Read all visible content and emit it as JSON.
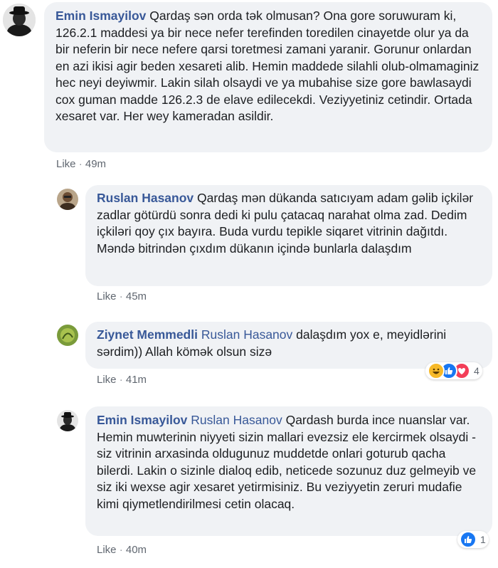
{
  "comments": [
    {
      "name": "Emin Ismayilov",
      "text": "Qardaş sən orda tək olmusan? Ona gore soruwuram ki, 126.2.1 maddesi ya bir nece nefer terefinden toredilen cinayetde olur ya da bir neferin bir nece nefere qarsi toretmesi zamani yaranir. Gorunur onlardan en azi ikisi agir beden xesareti alib. Hemin maddede silahli olub-olmamaginiz hec neyi deyiwmir. Lakin silah olsaydi ve ya mubahise size gore bawlasaydi cox guman madde 126.2.3 de elave edilecekdi. Veziyyetiniz cetindir. Ortada xesaret var. Her wey kameradan asildir.",
      "like": "Like",
      "sep": "·",
      "time": "49m"
    },
    {
      "name": "Ruslan Hasanov",
      "text": "Qardaş mən dükanda satıcıyam adam gəlib içkilər zadlar götürdü sonra dedi ki pulu çatacaq narahat olma zad. Dedim içkiləri qoy çıx bayıra. Buda vurdu tepikle siqaret vitrinin dağıtdı. Məndə bitrindən çıxdım dükanın içində bunlarla dalaşdım",
      "like": "Like",
      "sep": "·",
      "time": "45m"
    },
    {
      "name": "Ziynet Memmedli",
      "mention": "Ruslan Hasanov",
      "text": "dalaşdım yox e, meyidlərini sərdim)) Allah kömək olsun sizə",
      "like": "Like",
      "sep": "·",
      "time": "41m",
      "reactions": {
        "icons": [
          "haha-icon",
          "like-icon",
          "love-icon"
        ],
        "count": "4"
      }
    },
    {
      "name": "Emin Ismayilov",
      "mention": "Ruslan Hasanov",
      "text": "Qardash burda ince nuanslar var. Hemin muwterinin niyyeti sizin mallari evezsiz ele kercirmek olsaydi - siz vitrinin arxasinda oldugunuz muddetde onlari goturub qacha bilerdi. Lakin o sizinle dialoq edib, neticede sozunuz duz gelmeyib ve siz iki wexse agir xesaret yetirmisiniz. Bu veziyyetin zeruri mudafie kimi qiymetlendirilmesi cetin olacaq.",
      "like": "Like",
      "sep": "·",
      "time": "40m",
      "reactions": {
        "icons": [
          "like-icon"
        ],
        "count": "1"
      }
    }
  ],
  "colors": {
    "name": "#385898",
    "bubble": "#f0f2f5",
    "meta": "#606770",
    "like_blue": "#1877f2",
    "love_red": "#f33e58",
    "haha_yellow": "#f7b928"
  }
}
